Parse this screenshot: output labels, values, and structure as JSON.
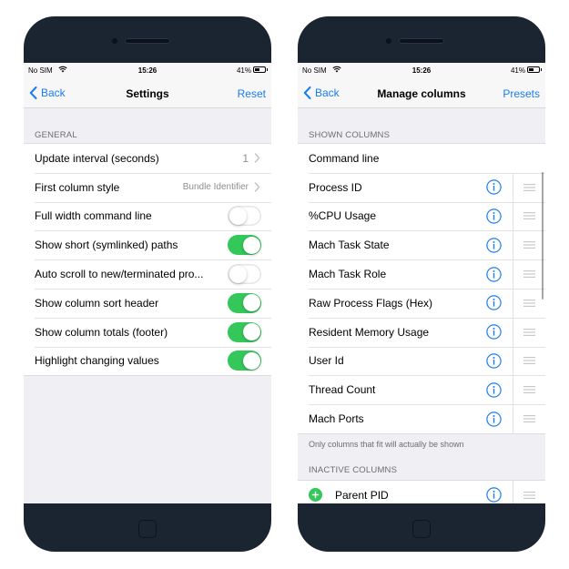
{
  "accent_color": "#1a7bf2",
  "toggle_on_color": "#34c759",
  "left_screen": {
    "status": {
      "carrier": "No SIM",
      "time": "15:26",
      "battery": "41%"
    },
    "nav": {
      "back": "Back",
      "title": "Settings",
      "right": "Reset"
    },
    "section_header": "GENERAL",
    "rows": [
      {
        "label": "Update interval (seconds)",
        "value": "1",
        "type": "disclosure"
      },
      {
        "label": "First column style",
        "value": "Bundle Identifier",
        "type": "disclosure"
      },
      {
        "label": "Full width command line",
        "type": "toggle",
        "on": false
      },
      {
        "label": "Show short (symlinked) paths",
        "type": "toggle",
        "on": true
      },
      {
        "label": "Auto scroll to new/terminated pro...",
        "type": "toggle",
        "on": false
      },
      {
        "label": "Show column sort header",
        "type": "toggle",
        "on": true
      },
      {
        "label": "Show column totals (footer)",
        "type": "toggle",
        "on": true
      },
      {
        "label": "Highlight changing values",
        "type": "toggle",
        "on": true
      }
    ]
  },
  "right_screen": {
    "status": {
      "carrier": "No SIM",
      "time": "15:26",
      "battery": "41%"
    },
    "nav": {
      "back": "Back",
      "title": "Manage columns",
      "right": "Presets"
    },
    "shown_header": "SHOWN COLUMNS",
    "shown_columns": [
      "Command line",
      "Process ID",
      "%CPU Usage",
      "Mach Task State",
      "Mach Task Role",
      "Raw Process Flags (Hex)",
      "Resident Memory Usage",
      "User Id",
      "Thread Count",
      "Mach Ports"
    ],
    "shown_footer": "Only columns that fit will actually be shown",
    "inactive_header": "INACTIVE COLUMNS",
    "inactive_columns": [
      "Parent PID"
    ]
  },
  "icons": {
    "back": "chevron-left-icon",
    "disclosure": "chevron-right-icon",
    "info": "info-circle-icon",
    "reorder": "drag-handle-icon",
    "add": "plus-circle-icon",
    "wifi": "wifi-icon",
    "battery": "battery-icon",
    "home": "home-button-icon"
  }
}
